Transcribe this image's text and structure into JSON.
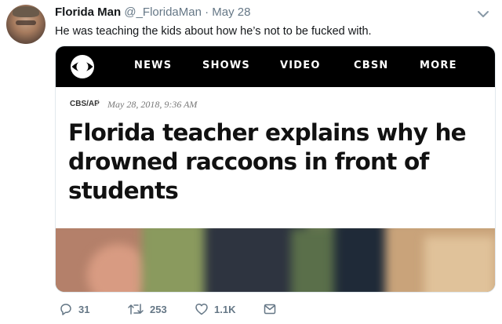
{
  "tweet": {
    "author_name": "Florida Man",
    "author_handle": "@_FloridaMan",
    "separator": "·",
    "date": "May 28",
    "text": "He was teaching the kids about how he’s not to be fucked with."
  },
  "card": {
    "nav": {
      "news": "NEWS",
      "shows": "SHOWS",
      "video": "VIDEO",
      "cbsn": "CBSN",
      "more": "MORE"
    },
    "source": "CBS/AP",
    "slash": "/",
    "pub_date": "May 28, 2018, 9:36 AM",
    "headline": "Florida teacher explains why he drowned raccoons in front of students"
  },
  "actions": {
    "reply_count": "31",
    "retweet_count": "253",
    "like_count": "1.1K"
  },
  "icons": [
    "chevron-down-icon",
    "cbs-eye-logo",
    "reply-icon",
    "retweet-icon",
    "like-icon",
    "message-icon"
  ]
}
